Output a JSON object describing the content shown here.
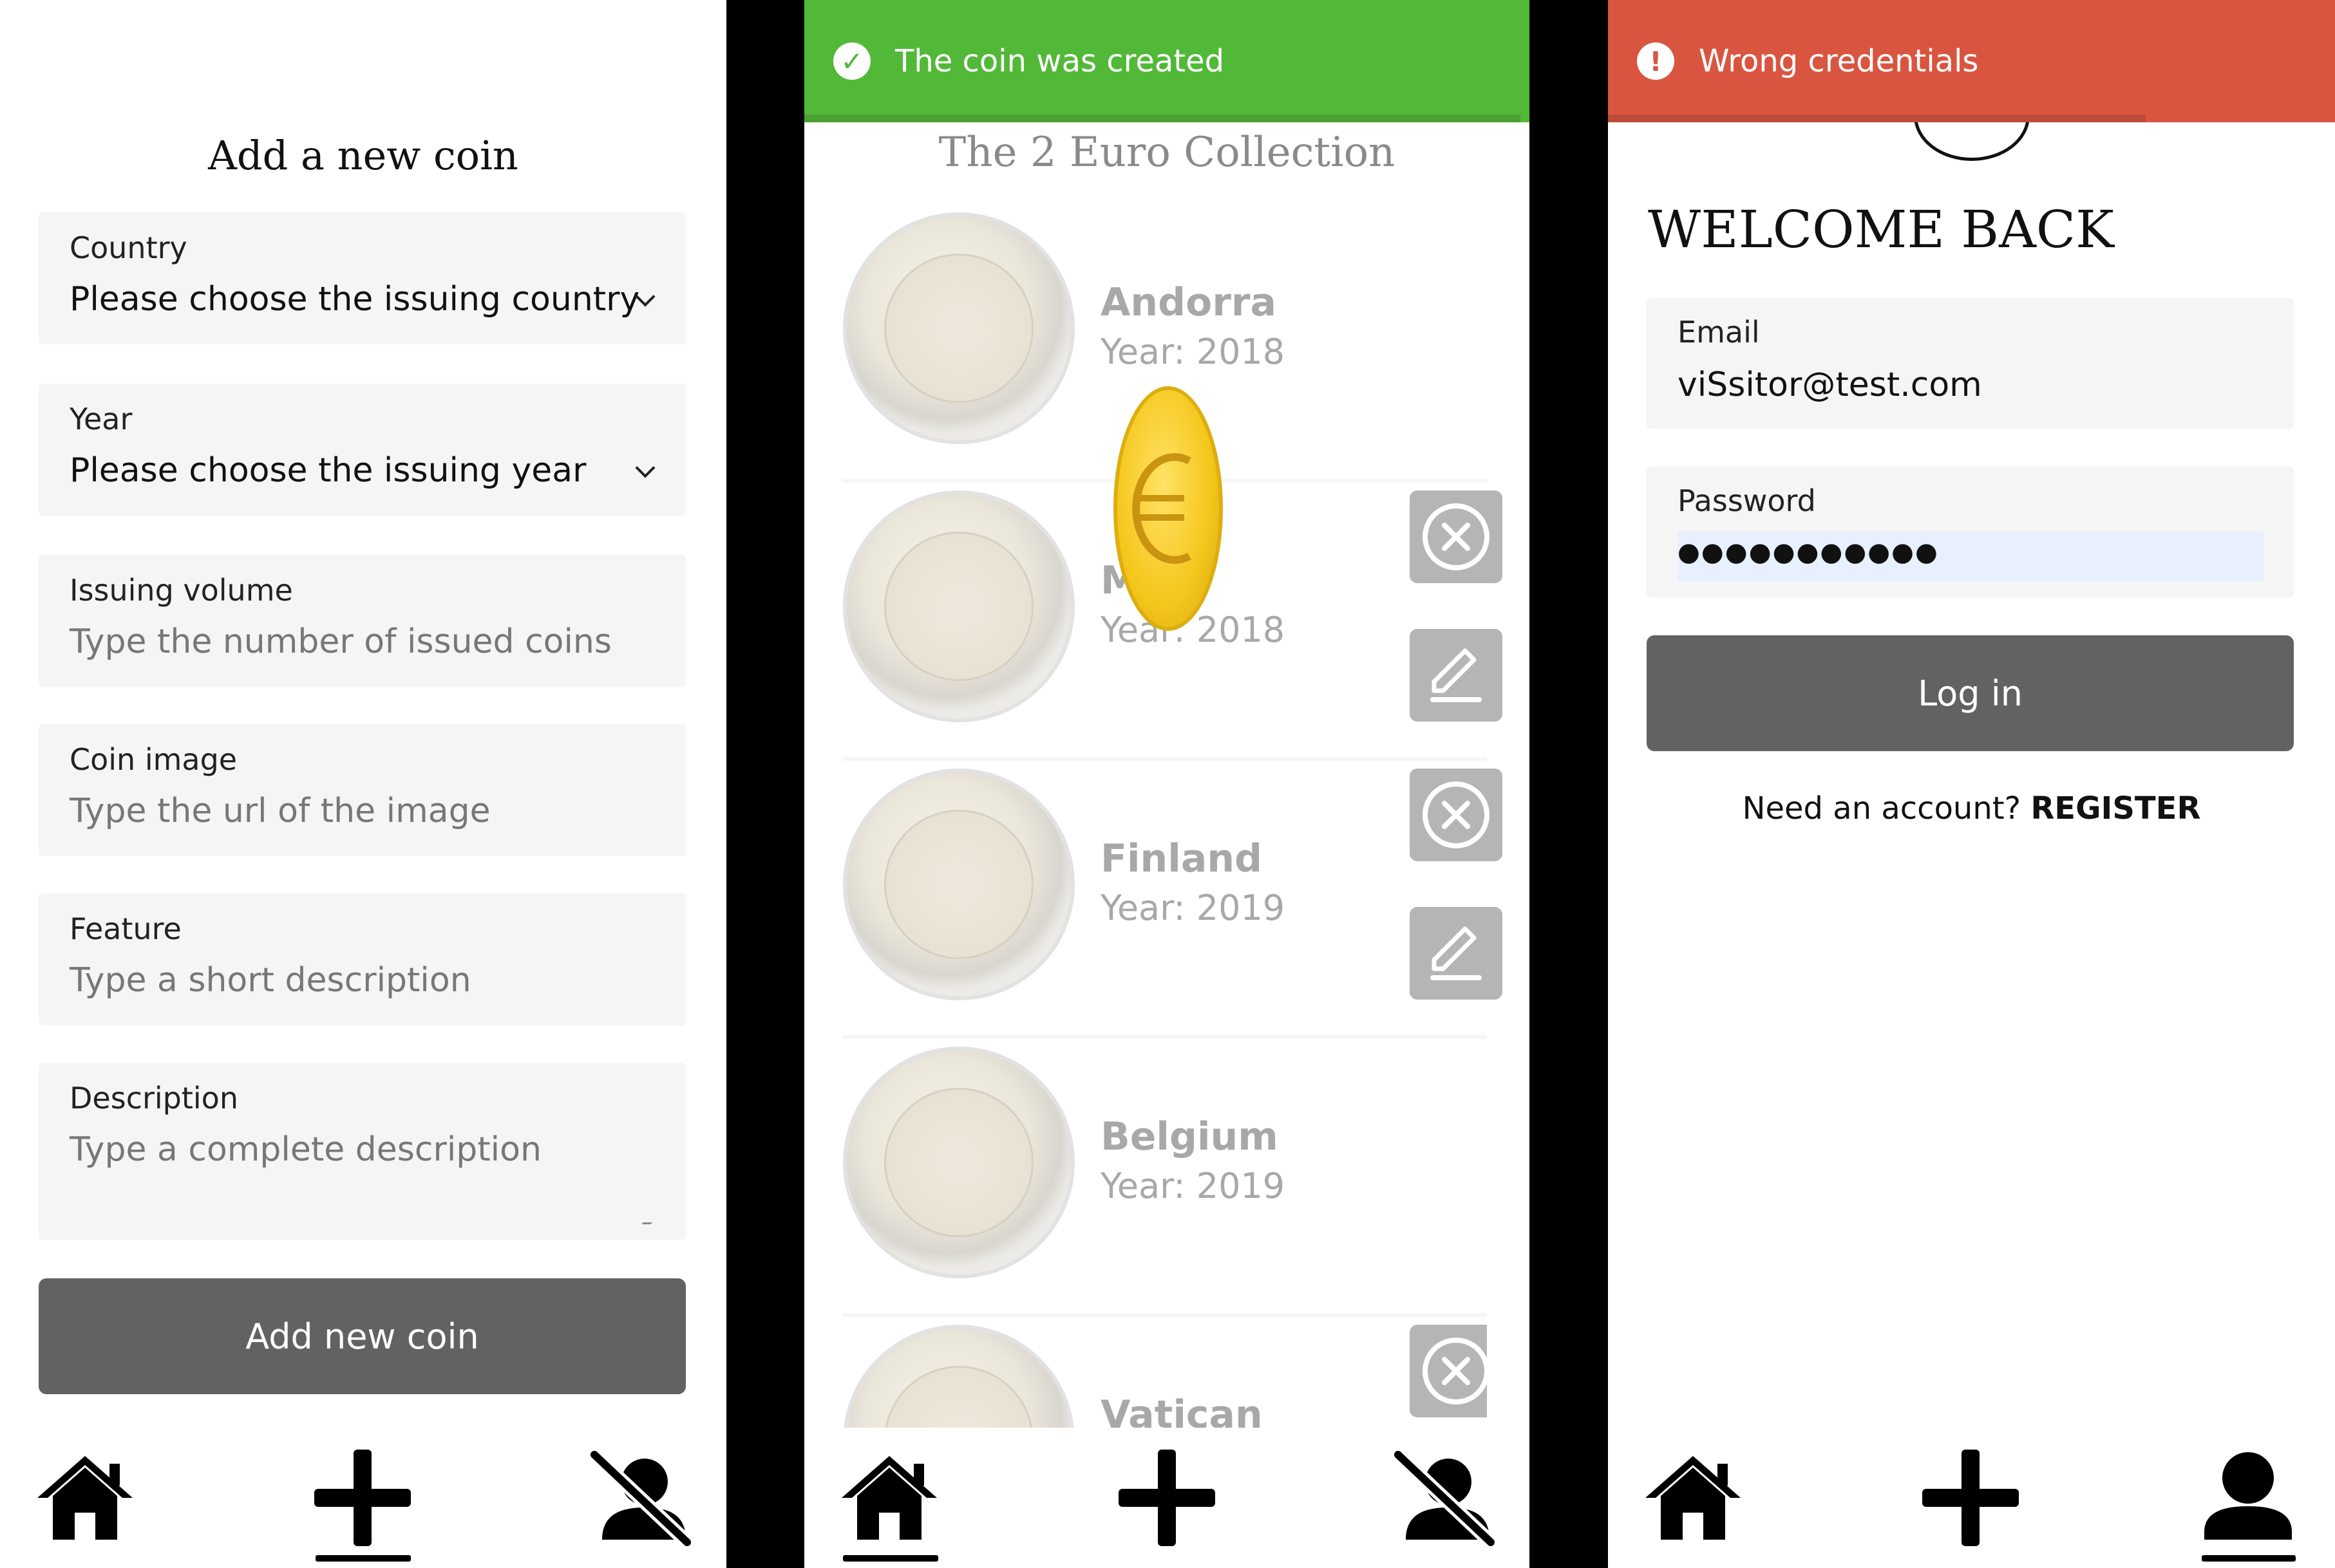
{
  "add_panel": {
    "title": "Add a new coin",
    "fields": {
      "country": {
        "label": "Country",
        "value": "Please choose the issuing country"
      },
      "year": {
        "label": "Year",
        "value": "Please choose the issuing year"
      },
      "volume": {
        "label": "Issuing volume",
        "placeholder": "Type the number of issued coins"
      },
      "image": {
        "label": "Coin image",
        "placeholder": "Type the url of the image"
      },
      "feature": {
        "label": "Feature",
        "placeholder": "Type a short description"
      },
      "description": {
        "label": "Description",
        "placeholder": "Type a complete description"
      }
    },
    "submit_label": "Add new coin"
  },
  "list_panel": {
    "toast": "The coin was created",
    "title": "The 2 Euro Collection",
    "coins": [
      {
        "name": "Andorra",
        "year": "Year: 2018"
      },
      {
        "name": "M",
        "year": "Year: 2018"
      },
      {
        "name": "Finland",
        "year": "Year: 2019"
      },
      {
        "name": "Belgium",
        "year": "Year: 2019"
      },
      {
        "name": "Vatican",
        "year": ""
      }
    ]
  },
  "login_panel": {
    "toast": "Wrong credentials",
    "title": "WELCOME BACK",
    "email_label": "Email",
    "email_value": "viSsitor@test.com",
    "password_label": "Password",
    "password_value": "●●●●●●●●●●●",
    "login_label": "Log in",
    "register_prompt": "Need an account?",
    "register_link": "REGISTER"
  },
  "colors": {
    "success": "#52b838",
    "error": "#d95540",
    "button": "#626262",
    "field_bg": "#f5f5f5",
    "gold": "#f5c61b"
  },
  "icons": [
    "home-icon",
    "plus-icon",
    "user-slash-icon",
    "user-icon",
    "check-circle-icon",
    "exclamation-circle-icon",
    "close-circle-icon",
    "pencil-icon",
    "chevron-down-icon",
    "euro-icon"
  ]
}
